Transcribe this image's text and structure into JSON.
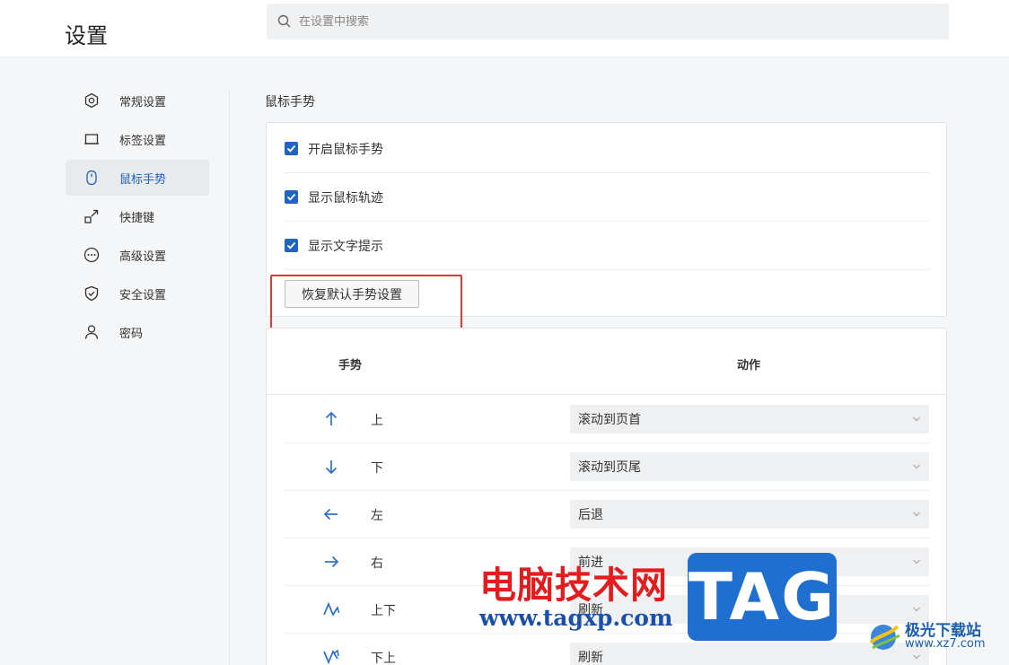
{
  "header": {
    "title": "设置",
    "search_placeholder": "在设置中搜索"
  },
  "sidebar": {
    "items": [
      {
        "label": "常规设置",
        "icon": "hexagon-gear-icon"
      },
      {
        "label": "标签设置",
        "icon": "tab-icon"
      },
      {
        "label": "鼠标手势",
        "icon": "mouse-icon",
        "active": true
      },
      {
        "label": "快捷键",
        "icon": "shortcut-icon"
      },
      {
        "label": "高级设置",
        "icon": "more-circle-icon"
      },
      {
        "label": "安全设置",
        "icon": "shield-icon"
      },
      {
        "label": "密码",
        "icon": "user-icon"
      }
    ]
  },
  "mouse_gesture": {
    "section_title": "鼠标手势",
    "options": [
      {
        "label": "开启鼠标手势",
        "checked": true
      },
      {
        "label": "显示鼠标轨迹",
        "checked": true
      },
      {
        "label": "显示文字提示",
        "checked": true
      }
    ],
    "reset_button": "恢复默认手势设置"
  },
  "gesture_table": {
    "col_gesture": "手势",
    "col_action": "动作",
    "rows": [
      {
        "gesture": "上",
        "icon": "arrow-up-icon",
        "action": "滚动到页首"
      },
      {
        "gesture": "下",
        "icon": "arrow-down-icon",
        "action": "滚动到页尾"
      },
      {
        "gesture": "左",
        "icon": "arrow-left-icon",
        "action": "后退"
      },
      {
        "gesture": "右",
        "icon": "arrow-right-icon",
        "action": "前进"
      },
      {
        "gesture": "上下",
        "icon": "arrow-up-down-icon",
        "action": "刷新"
      },
      {
        "gesture": "下上",
        "icon": "arrow-down-up-icon",
        "action": "刷新"
      }
    ]
  },
  "watermark": {
    "site_name": "电脑技术网",
    "site_url": "www.tagxp.com",
    "tag": "TAG",
    "logo_name": "极光下载站",
    "logo_url": "www.xz7.com"
  },
  "colors": {
    "accent": "#1f64c4",
    "highlight": "#e23a32"
  }
}
